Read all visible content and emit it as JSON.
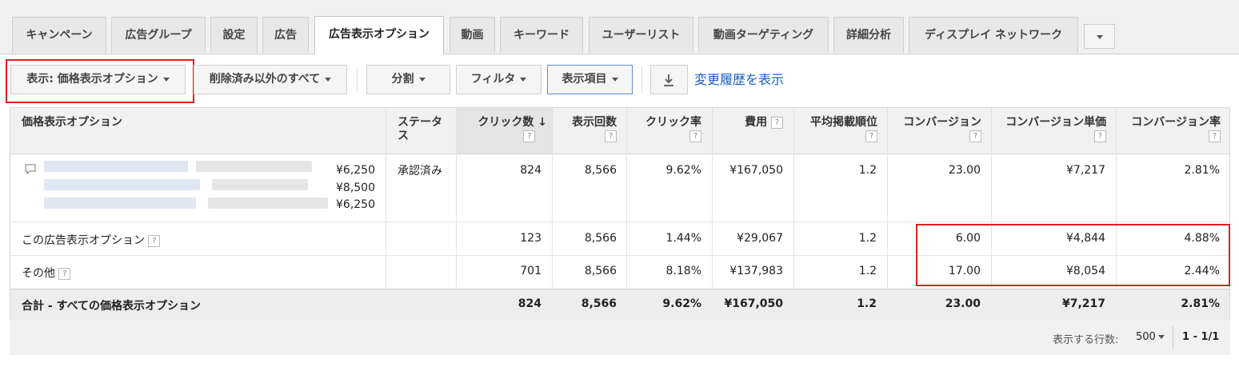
{
  "tabs": [
    {
      "label": "キャンペーン"
    },
    {
      "label": "広告グループ"
    },
    {
      "label": "設定"
    },
    {
      "label": "広告"
    },
    {
      "label": "広告表示オプション"
    },
    {
      "label": "動画"
    },
    {
      "label": "キーワード"
    },
    {
      "label": "ユーザーリスト"
    },
    {
      "label": "動画ターゲティング"
    },
    {
      "label": "詳細分析"
    },
    {
      "label": "ディスプレイ ネットワーク"
    }
  ],
  "toolbar": {
    "view_label": "表示: 価格表示オプション",
    "status_filter": "削除済み以外のすべて",
    "segment": "分割",
    "filter": "フィルタ",
    "columns": "表示項目",
    "history_link": "変更履歴を表示"
  },
  "table": {
    "headers": {
      "option": "価格表示オプション",
      "status": "ステータス",
      "clicks": "クリック数",
      "impressions": "表示回数",
      "ctr": "クリック率",
      "cost": "費用",
      "avg_pos": "平均掲載順位",
      "conversions": "コンバージョン",
      "cost_per_conv": "コンバージョン単価",
      "conv_rate": "コンバージョン率"
    },
    "help": "?",
    "rows": [
      {
        "prices": [
          "¥6,250",
          "¥8,500",
          "¥6,250"
        ],
        "status": "承認済み",
        "clicks": "824",
        "impressions": "8,566",
        "ctr": "9.62%",
        "cost": "¥167,050",
        "avg_pos": "1.2",
        "conversions": "23.00",
        "cost_per_conv": "¥7,217",
        "conv_rate": "2.81%"
      },
      {
        "label": "この広告表示オプション",
        "clicks": "123",
        "impressions": "8,566",
        "ctr": "1.44%",
        "cost": "¥29,067",
        "avg_pos": "1.2",
        "conversions": "6.00",
        "cost_per_conv": "¥4,844",
        "conv_rate": "4.88%"
      },
      {
        "label": "その他",
        "clicks": "701",
        "impressions": "8,566",
        "ctr": "8.18%",
        "cost": "¥137,983",
        "avg_pos": "1.2",
        "conversions": "17.00",
        "cost_per_conv": "¥8,054",
        "conv_rate": "2.44%"
      }
    ],
    "total": {
      "label": "合計 - すべての価格表示オプション",
      "clicks": "824",
      "impressions": "8,566",
      "ctr": "9.62%",
      "cost": "¥167,050",
      "avg_pos": "1.2",
      "conversions": "23.00",
      "cost_per_conv": "¥7,217",
      "conv_rate": "2.81%"
    }
  },
  "footer": {
    "rows_label": "表示する行数:",
    "rows_value": "500",
    "range": "1 - 1/1"
  },
  "colors": {
    "highlight": "#e02020",
    "link": "#1a5cc8"
  }
}
